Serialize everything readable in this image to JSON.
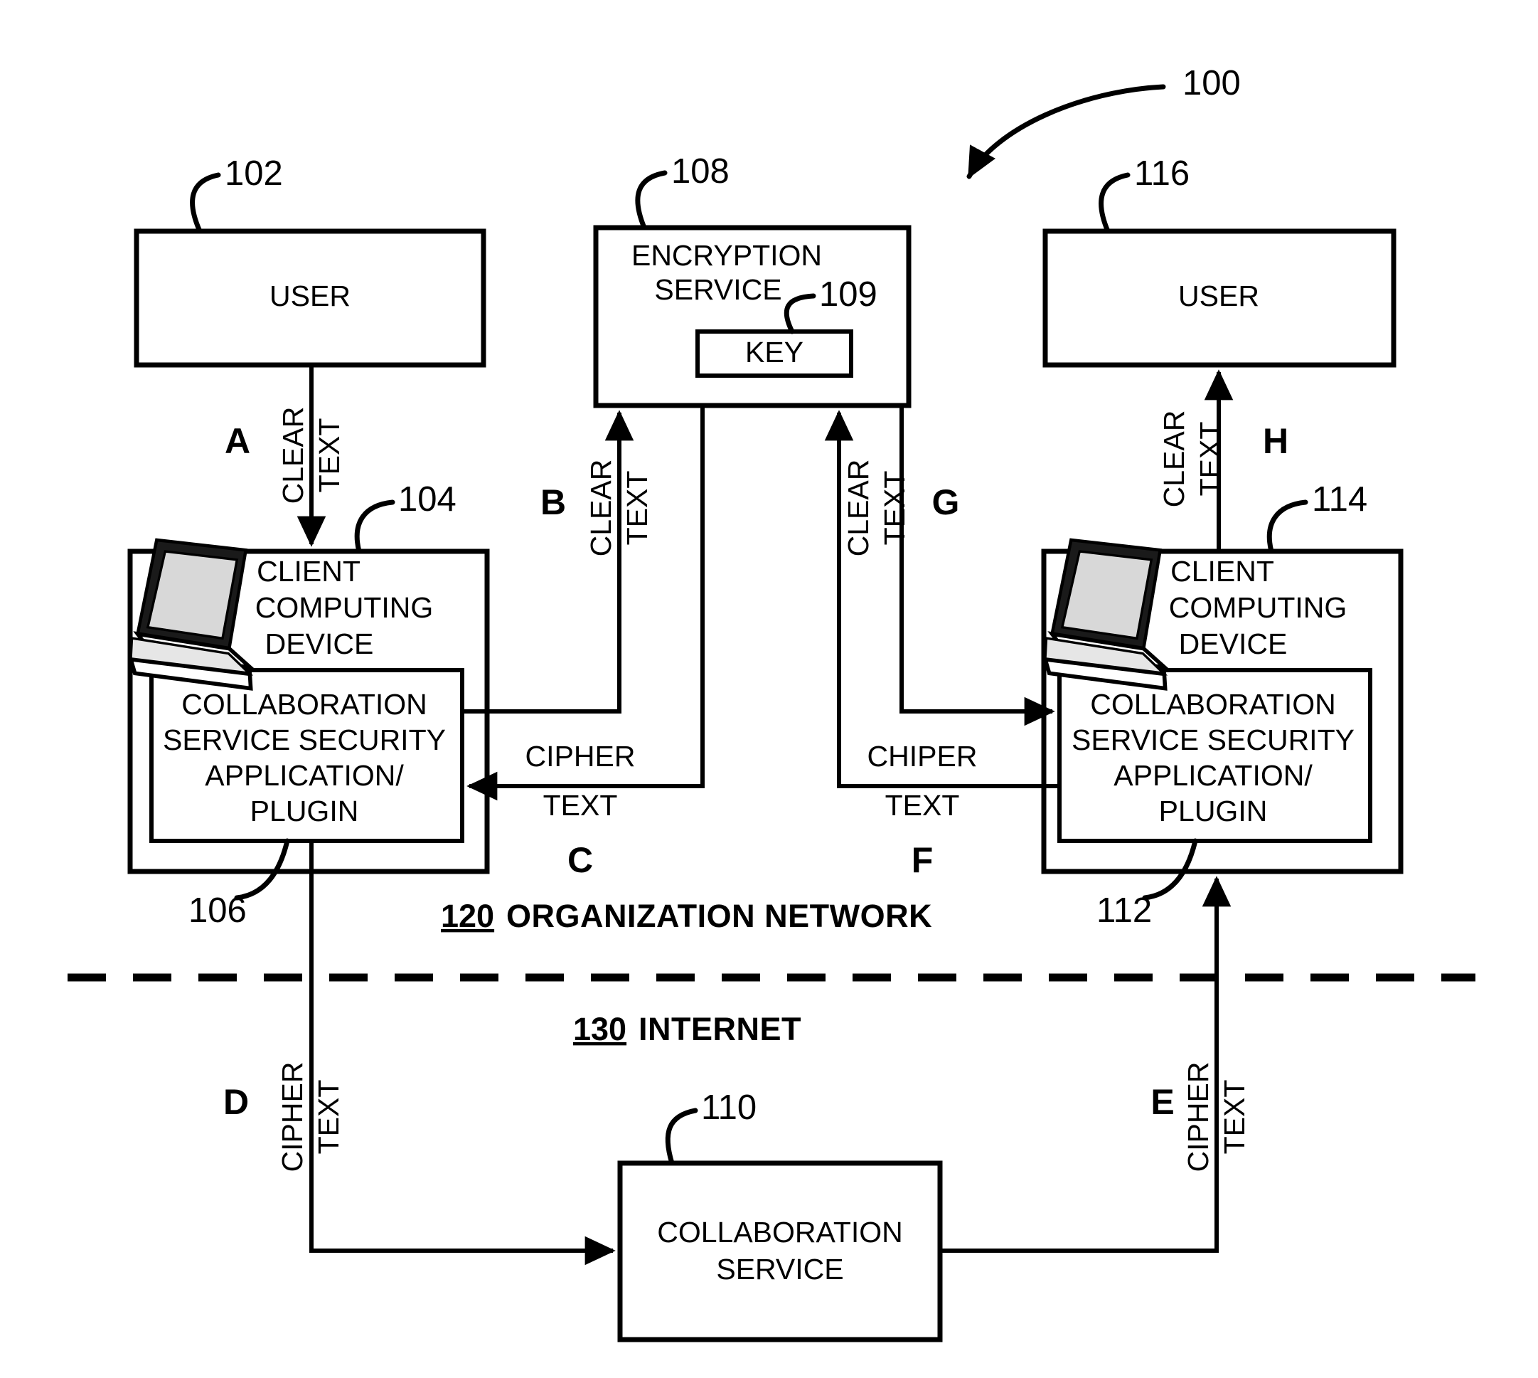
{
  "figure": {
    "label_100": "100",
    "zones": [
      {
        "num": "120",
        "name": "ORGANIZATION NETWORK"
      },
      {
        "num": "130",
        "name": "INTERNET"
      }
    ]
  },
  "boxes": {
    "user_left": {
      "ref": "102",
      "label": "USER"
    },
    "user_right": {
      "ref": "116",
      "label": "USER"
    },
    "encryption": {
      "ref": "108",
      "line1": "ENCRYPTION",
      "line2": "SERVICE"
    },
    "key": {
      "ref": "109",
      "label": "KEY"
    },
    "client_left": {
      "ref": "104",
      "line1": "CLIENT",
      "line2": "COMPUTING",
      "line3": "DEVICE"
    },
    "client_right": {
      "ref": "114",
      "line1": "CLIENT",
      "line2": "COMPUTING",
      "line3": "DEVICE"
    },
    "plugin_left": {
      "ref": "106",
      "line1": "COLLABORATION",
      "line2": "SERVICE SECURITY",
      "line3": "APPLICATION/",
      "line4": "PLUGIN"
    },
    "plugin_right": {
      "ref": "112",
      "line1": "COLLABORATION",
      "line2": "SERVICE SECURITY",
      "line3": "APPLICATION/",
      "line4": "PLUGIN"
    },
    "collab_service": {
      "ref": "110",
      "line1": "COLLABORATION",
      "line2": "SERVICE"
    }
  },
  "flows": [
    {
      "step": "A",
      "word1": "CLEAR",
      "word2": "TEXT"
    },
    {
      "step": "B",
      "word1": "CLEAR",
      "word2": "TEXT"
    },
    {
      "step": "C",
      "word1": "CIPHER",
      "word2": "TEXT"
    },
    {
      "step": "D",
      "word1": "CIPHER",
      "word2": "TEXT"
    },
    {
      "step": "E",
      "word1": "CIPHER",
      "word2": "TEXT"
    },
    {
      "step": "F",
      "word1": "CHIPER",
      "word2": "TEXT"
    },
    {
      "step": "G",
      "word1": "CLEAR",
      "word2": "TEXT"
    },
    {
      "step": "H",
      "word1": "CLEAR",
      "word2": "TEXT"
    }
  ],
  "colors": {
    "ink": "#000000",
    "paper": "#ffffff"
  }
}
